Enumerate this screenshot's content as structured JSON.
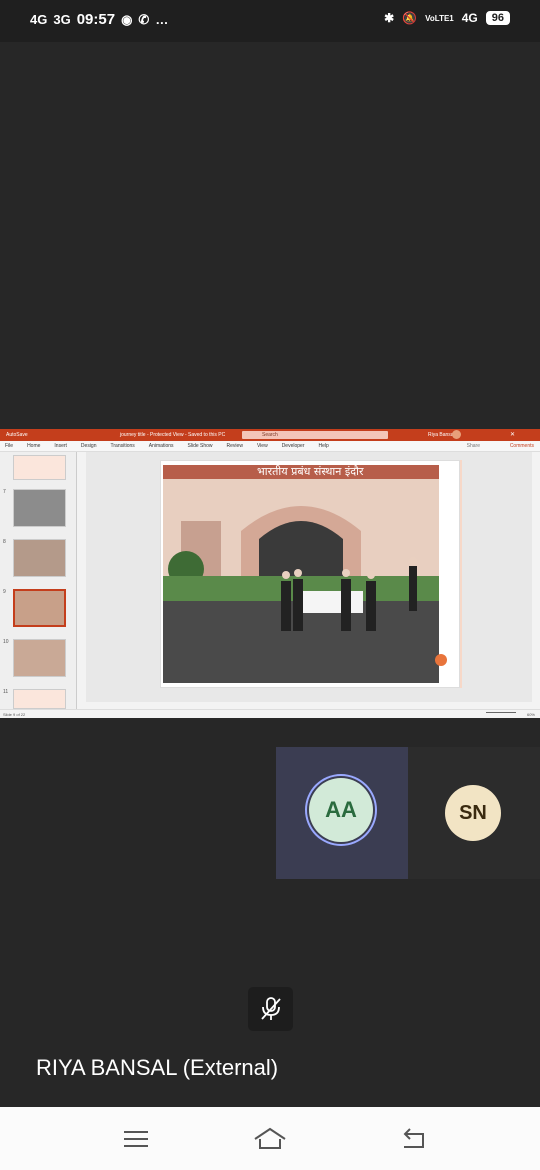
{
  "status_bar": {
    "network_1": "4G",
    "network_2": "3G",
    "time": "09:57",
    "more": "…",
    "volte": "VoLTE1",
    "network_3": "4G",
    "battery": "96"
  },
  "share": {
    "ppt": {
      "autosave": "AutoSave",
      "file_title": "journey title - Protected View - Saved to this PC",
      "search_placeholder": "Search",
      "user": "Riya Bansal",
      "menu": [
        "File",
        "Home",
        "Insert",
        "Design",
        "Transitions",
        "Animations",
        "Slide Show",
        "Review",
        "View",
        "Developer",
        "Help"
      ],
      "share_label": "Share",
      "comments_label": "Comments",
      "slide_numbers": [
        "7",
        "8",
        "9",
        "10",
        "11"
      ],
      "slide_banner_text": "भारतीय प्रबंध संस्थान इंदौर",
      "status_left": "Slide 9 of 22",
      "zoom": "60%"
    }
  },
  "participants": [
    {
      "initials": "AA",
      "color": "#d2ead8"
    },
    {
      "initials": "SN",
      "color": "#f2e4c4"
    }
  ],
  "presenter_name": "RIYA BANSAL (External)",
  "icons": {
    "mic": "mic-off-icon",
    "nav_menu": "menu-icon",
    "nav_home": "home-icon",
    "nav_back": "back-icon"
  }
}
